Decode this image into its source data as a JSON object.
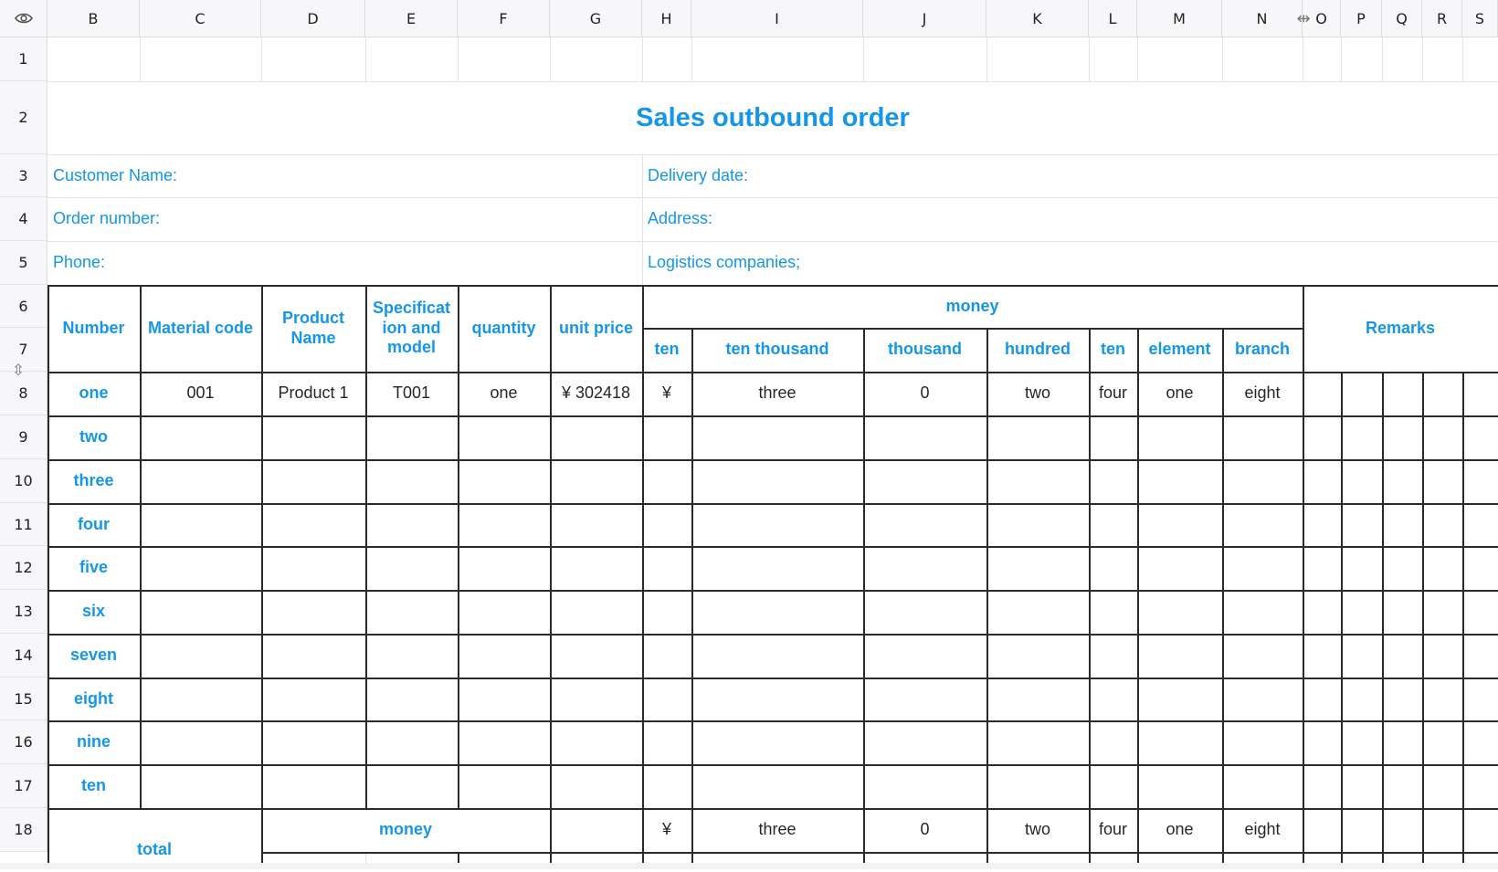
{
  "sheet": {
    "columns": [
      "B",
      "C",
      "D",
      "E",
      "F",
      "G",
      "H",
      "I",
      "J",
      "K",
      "L",
      "M",
      "N",
      "O",
      "P",
      "Q",
      "R",
      "S"
    ],
    "rows": [
      "1",
      "2",
      "3",
      "4",
      "5",
      "6",
      "7",
      "8",
      "9",
      "10",
      "11",
      "12",
      "13",
      "14",
      "15",
      "16",
      "17",
      "18"
    ],
    "visibility_icon": "eye-icon",
    "resize_handle_icon": "column-resize-icon",
    "row_resize_icon": "row-resize-icon"
  },
  "form": {
    "title": "Sales outbound order",
    "customer_name_label": "Customer Name:",
    "delivery_date_label": "Delivery date:",
    "order_number_label": "Order number:",
    "address_label": "Address:",
    "phone_label": "Phone:",
    "logistics_label": "Logistics companies;"
  },
  "table": {
    "headers": {
      "number": "Number",
      "material_code": "Material code",
      "product_name": "Product Name",
      "spec": "Specificat ion and model",
      "quantity": "quantity",
      "unit_price": "unit price",
      "money": "money",
      "remarks": "Remarks"
    },
    "money_columns": [
      "ten",
      "ten thousand",
      "thousand",
      "hundred",
      "ten",
      "element",
      "branch"
    ],
    "row_numbers": [
      "one",
      "two",
      "three",
      "four",
      "five",
      "six",
      "seven",
      "eight",
      "nine",
      "ten"
    ],
    "first_row": {
      "material_code": "001",
      "product_name": "Product 1",
      "spec": "T001",
      "quantity": "one",
      "unit_price": "¥ 302418",
      "money": [
        "¥",
        "three",
        "0",
        "two",
        "four",
        "one",
        "eight"
      ]
    }
  },
  "total": {
    "label": "total",
    "money_label": "money",
    "money": [
      "¥",
      "three",
      "0",
      "two",
      "four",
      "one",
      "eight"
    ]
  },
  "colors": {
    "accent": "#1596e8",
    "text": "#262626",
    "border": "#2a2a2a",
    "gridline": "#e3e3e6",
    "header_bg": "#f7f7f9"
  }
}
